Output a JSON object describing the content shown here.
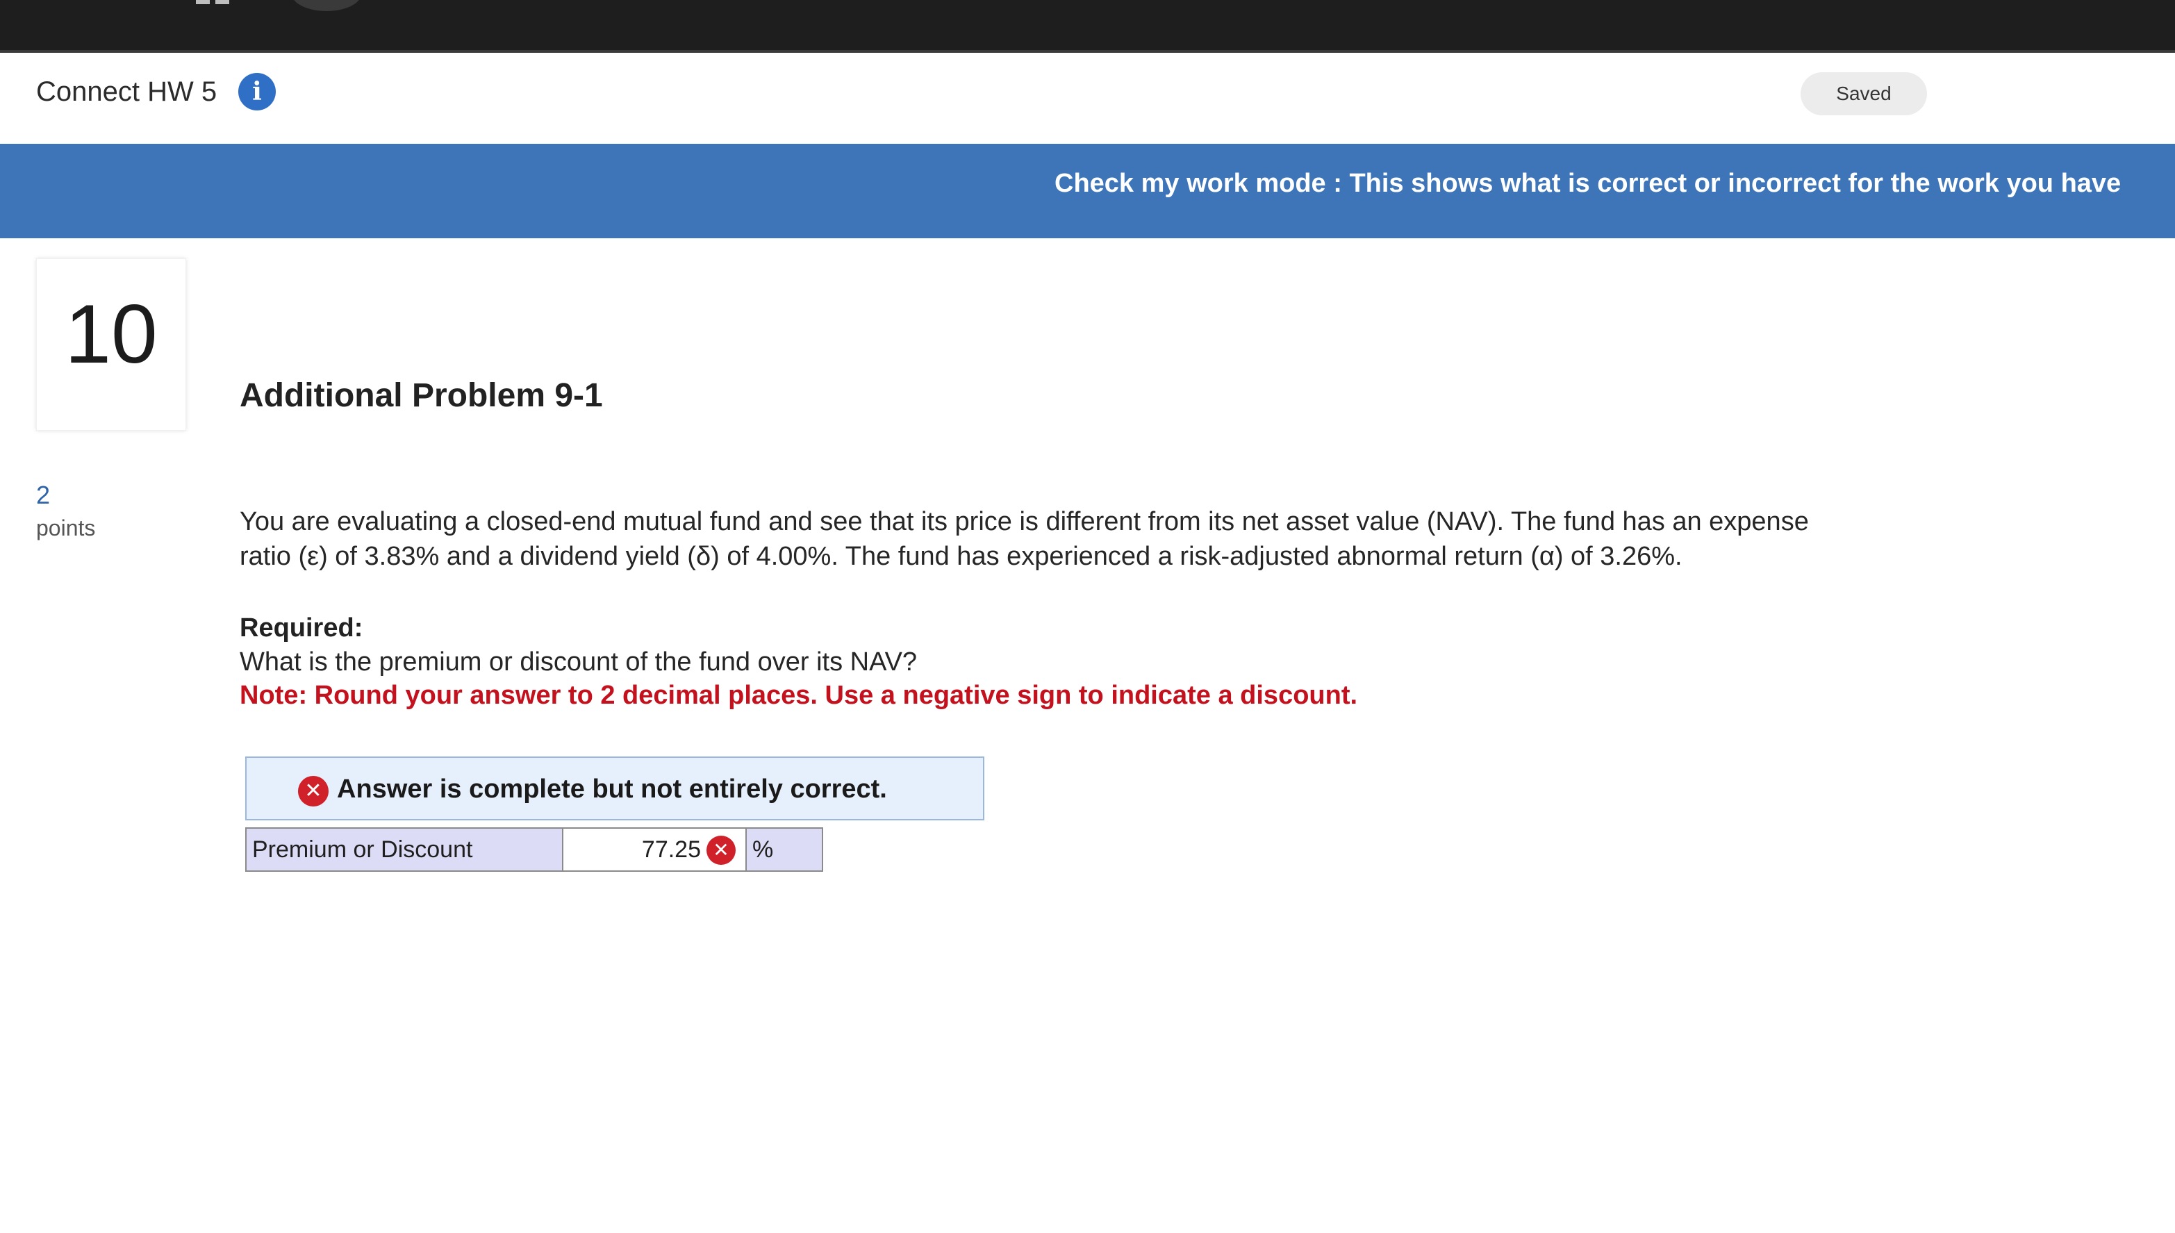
{
  "header": {
    "title": "Connect HW 5",
    "info_icon": "info-icon",
    "status": "Saved"
  },
  "banner": {
    "text": "Check my work mode : This shows what is correct or incorrect for the work you have"
  },
  "question": {
    "number": "10",
    "points_value": "2",
    "points_label": "points",
    "title": "Additional Problem 9-1",
    "body_line_1": "You are evaluating a closed-end mutual fund and see that its price is different from its net asset value (NAV). The fund has an expense",
    "body_line_2": "ratio (ε) of 3.83% and a dividend yield (δ) of 4.00%. The fund has experienced a risk-adjusted abnormal return (α) of 3.26%.",
    "required_label": "Required:",
    "required_question": "What is the premium or discount of the fund over its NAV?",
    "note": "Note: Round your answer to 2 decimal places. Use a negative sign to indicate a discount."
  },
  "feedback": {
    "icon": "error-x-icon",
    "text": "Answer is complete but not entirely correct."
  },
  "answer": {
    "label": "Premium or Discount",
    "value": "77.25",
    "unit": "%",
    "status_icon": "error-x-icon"
  },
  "colors": {
    "banner": "#3d75b8",
    "info": "#2f6fc6",
    "error": "#d0202a",
    "note": "#c3121e",
    "cell_shade": "#dcdcf6",
    "feedback_bg": "#e6f0fc"
  }
}
